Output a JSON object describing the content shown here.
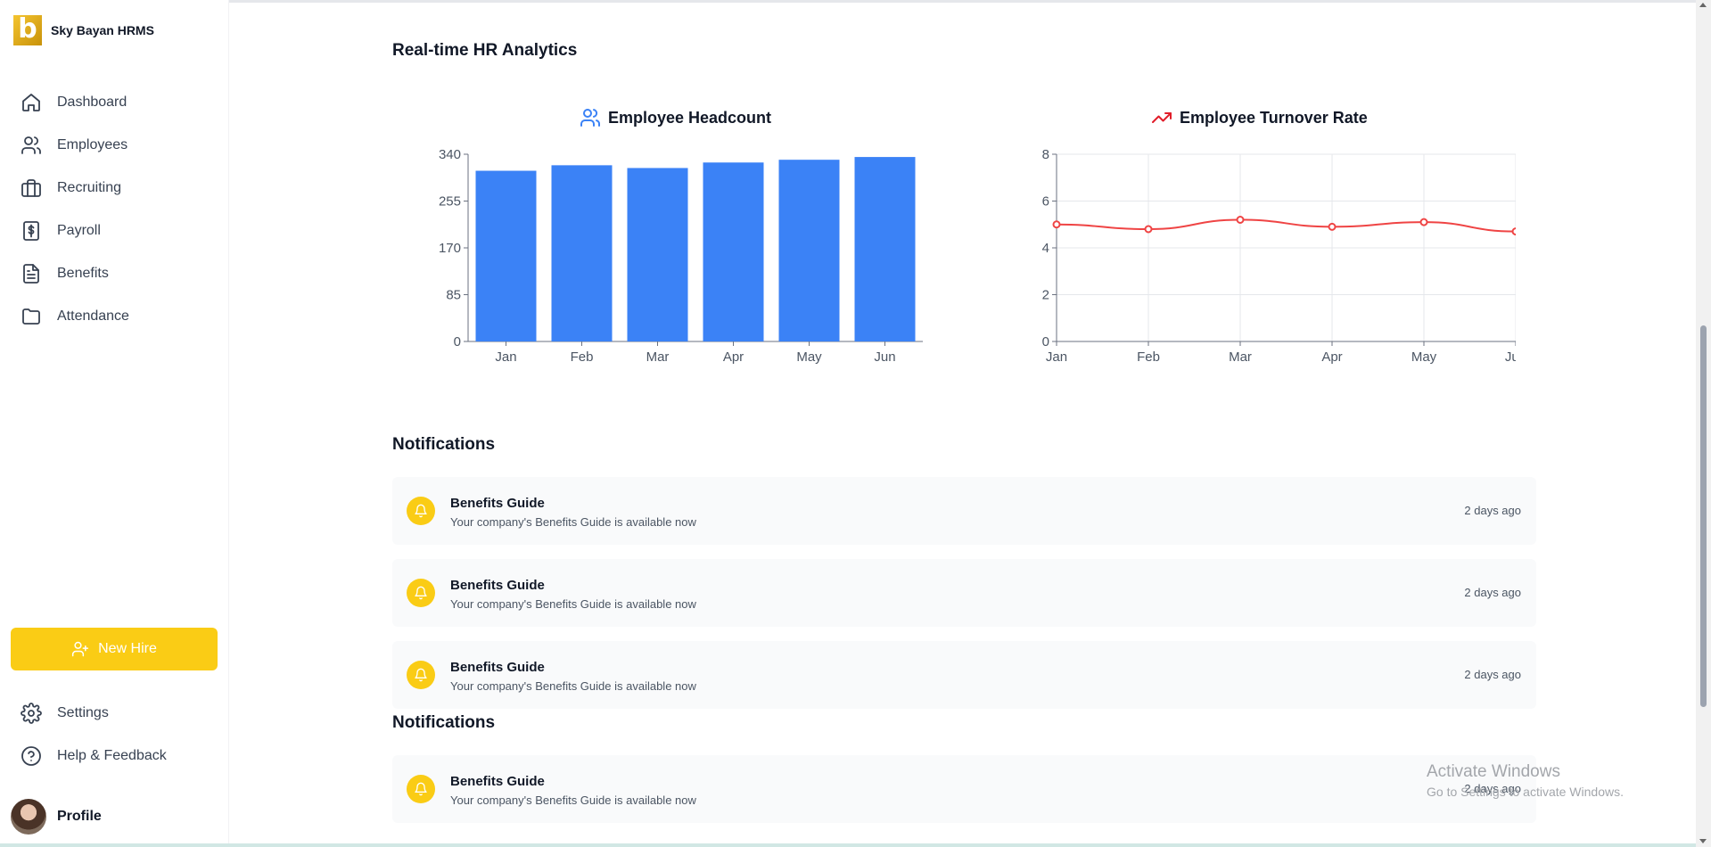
{
  "brand": {
    "name": "Sky Bayan HRMS",
    "logo_letter": "b"
  },
  "sidebar": {
    "items": [
      {
        "label": "Dashboard",
        "icon": "home-icon"
      },
      {
        "label": "Employees",
        "icon": "users-icon"
      },
      {
        "label": "Recruiting",
        "icon": "briefcase-icon"
      },
      {
        "label": "Payroll",
        "icon": "dollar-icon"
      },
      {
        "label": "Benefits",
        "icon": "document-icon"
      },
      {
        "label": "Attendance",
        "icon": "folder-icon"
      }
    ],
    "new_hire_label": "New Hire",
    "settings_label": "Settings",
    "help_label": "Help & Feedback",
    "profile_label": "Profile"
  },
  "analytics": {
    "title": "Real-time HR Analytics"
  },
  "chart_data": [
    {
      "type": "bar",
      "title": "Employee Headcount",
      "categories": [
        "Jan",
        "Feb",
        "Mar",
        "Apr",
        "May",
        "Jun"
      ],
      "values": [
        310,
        320,
        315,
        325,
        330,
        335
      ],
      "yticks": [
        0,
        85,
        170,
        255,
        340
      ],
      "ylim": [
        0,
        340
      ],
      "color": "#3b82f6",
      "xlabel": "",
      "ylabel": ""
    },
    {
      "type": "line",
      "title": "Employee Turnover Rate",
      "categories": [
        "Jan",
        "Feb",
        "Mar",
        "Apr",
        "May",
        "Jun"
      ],
      "values": [
        5.0,
        4.8,
        5.2,
        4.9,
        5.1,
        4.7
      ],
      "yticks": [
        0,
        2,
        4,
        6,
        8
      ],
      "ylim": [
        0,
        8
      ],
      "grid": true,
      "color": "#ef4444",
      "xlabel": "",
      "ylabel": ""
    }
  ],
  "notifications_title": "Notifications",
  "notifications": [
    {
      "title": "Benefits Guide",
      "message": "Your company's Benefits Guide is available now",
      "time": "2 days ago"
    },
    {
      "title": "Benefits Guide",
      "message": "Your company's Benefits Guide is available now",
      "time": "2 days ago"
    },
    {
      "title": "Benefits Guide",
      "message": "Your company's Benefits Guide is available now",
      "time": "2 days ago"
    }
  ],
  "notifications2_title": "Notifications",
  "notifications2": [
    {
      "title": "Benefits Guide",
      "message": "Your company's Benefits Guide is available now",
      "time": "2 days ago"
    }
  ],
  "watermark": {
    "line1": "Activate Windows",
    "line2": "Go to Settings to activate Windows."
  },
  "colors": {
    "accent": "#facc15",
    "bar": "#3b82f6",
    "line": "#ef4444"
  }
}
